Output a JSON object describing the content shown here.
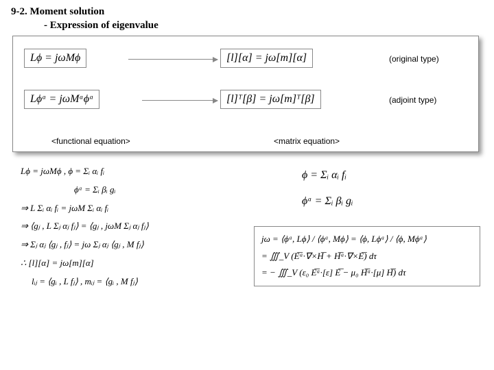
{
  "header": {
    "line1": "9-2. Moment solution",
    "line2": "- Expression of eigenvalue"
  },
  "top": {
    "func_orig": "Lϕ = jωMϕ",
    "matrix_orig": "[l][α] = jω[m][α]",
    "orig_label": "(original type)",
    "func_adj": "Lϕᵃ = jωMᵃϕᵃ",
    "matrix_adj": "[l]ᵀ[β] = jω[m]ᵀ[β]",
    "adj_label": "(adjoint type)",
    "col1_label": "<functional equation>",
    "col2_label": "<matrix equation>"
  },
  "left_col": {
    "r1": "Lϕ = jωMϕ  ,  ϕ = Σᵢ αᵢ fᵢ",
    "r2": "ϕᵃ = Σᵢ βᵢ gᵢ",
    "r3": "⇒ L Σᵢ αᵢ fᵢ = jωM Σᵢ αᵢ fᵢ",
    "r4": "⇒ ⟨gⱼ , L Σⱼ αⱼ fⱼ⟩ = ⟨gⱼ , jωM Σⱼ αⱼ fⱼ⟩",
    "r5": "⇒ Σⱼ αⱼ ⟨gⱼ , fⱼ⟩ = jω Σⱼ αⱼ ⟨gⱼ , M fⱼ⟩",
    "r6": "∴ [l][α] = jω[m][α]",
    "r7": "lᵢⱼ = ⟨gᵢ , L fⱼ⟩  ,  mᵢⱼ = ⟨gᵢ , M fⱼ⟩"
  },
  "right_col": {
    "r1": "ϕ = Σᵢ αᵢ fᵢ",
    "r2": "ϕᵃ = Σᵢ βᵢ gᵢ"
  },
  "right_box": {
    "r1": "jω = ⟨ϕᵃ, Lϕ⟩ / ⟨ϕᵃ, Mϕ⟩ = ⟨ϕ, Lϕᵃ⟩ / ⟨ϕ, Mϕᵃ⟩",
    "r2": "= ∭_V (E͞ᵃ·∇×H͞ + H͞ᵃ·∇×E͞) dτ",
    "r3": "= − ∭_V (ε₀ E͞ᵃ·[ε] E͞ − μ₀ H͞ᵃ·[μ] H͞) dτ"
  }
}
